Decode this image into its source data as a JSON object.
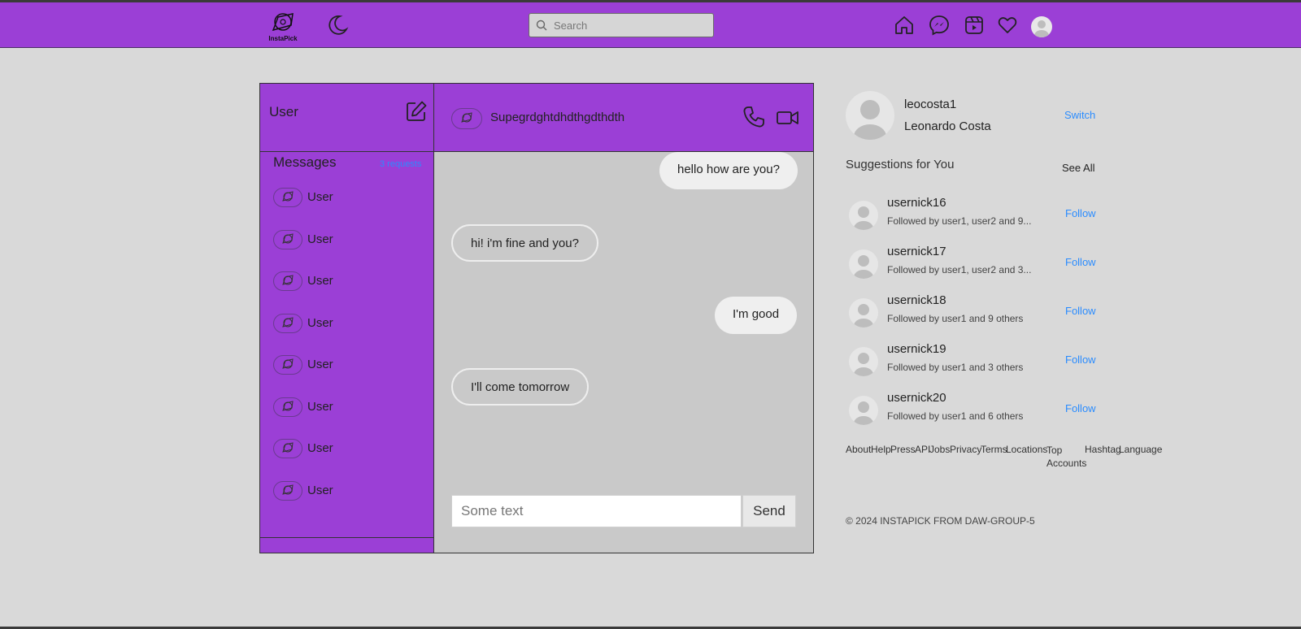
{
  "header": {
    "logo_text": "InstaPick",
    "search_placeholder": "Search"
  },
  "sidebar": {
    "user_label": "User",
    "messages_title": "Messages",
    "requests_label": "3 requests",
    "conversations": [
      {
        "name": "User"
      },
      {
        "name": "User"
      },
      {
        "name": "User"
      },
      {
        "name": "User"
      },
      {
        "name": "User"
      },
      {
        "name": "User"
      },
      {
        "name": "User"
      },
      {
        "name": "User"
      }
    ]
  },
  "chat": {
    "contact_name": "Supegrdghtdhdthgdthdth",
    "messages": [
      {
        "text": "hello how are you?",
        "direction": "out"
      },
      {
        "text": "hi! i'm fine and you?",
        "direction": "in"
      },
      {
        "text": "I'm good",
        "direction": "out"
      },
      {
        "text": "I'll come tomorrow",
        "direction": "in"
      }
    ],
    "input_placeholder": "Some text",
    "send_label": "Send"
  },
  "profile": {
    "username": "leocosta1",
    "full_name": "Leonardo Costa",
    "switch_label": "Switch"
  },
  "suggestions": {
    "title": "Suggestions for You",
    "see_all_label": "See All",
    "follow_label": "Follow",
    "items": [
      {
        "username": "usernick16",
        "followed_by": "Followed by user1, user2 and 9..."
      },
      {
        "username": "usernick17",
        "followed_by": "Followed by user1, user2 and 3..."
      },
      {
        "username": "usernick18",
        "followed_by": "Followed by user1 and 9 others"
      },
      {
        "username": "usernick19",
        "followed_by": "Followed by user1 and 3 others"
      },
      {
        "username": "usernick20",
        "followed_by": "Followed by user1 and 6 others"
      }
    ]
  },
  "footer": {
    "links": [
      "About",
      "Help",
      "Press",
      "API",
      "Jobs",
      "Privacy",
      "Terms",
      "Locations",
      "Top Accounts",
      "Hashtag",
      "Language"
    ],
    "copyright": "© 2024 INSTAPICK FROM DAW-GROUP-5"
  },
  "colors": {
    "accent": "#9b3fd6",
    "link": "#2a8cff",
    "background": "#d9d9d9"
  },
  "icons": [
    "logo-icon",
    "moon-icon",
    "search-icon",
    "home-icon",
    "messenger-icon",
    "reels-icon",
    "heart-icon",
    "avatar",
    "edit-icon",
    "phone-icon",
    "video-icon"
  ]
}
